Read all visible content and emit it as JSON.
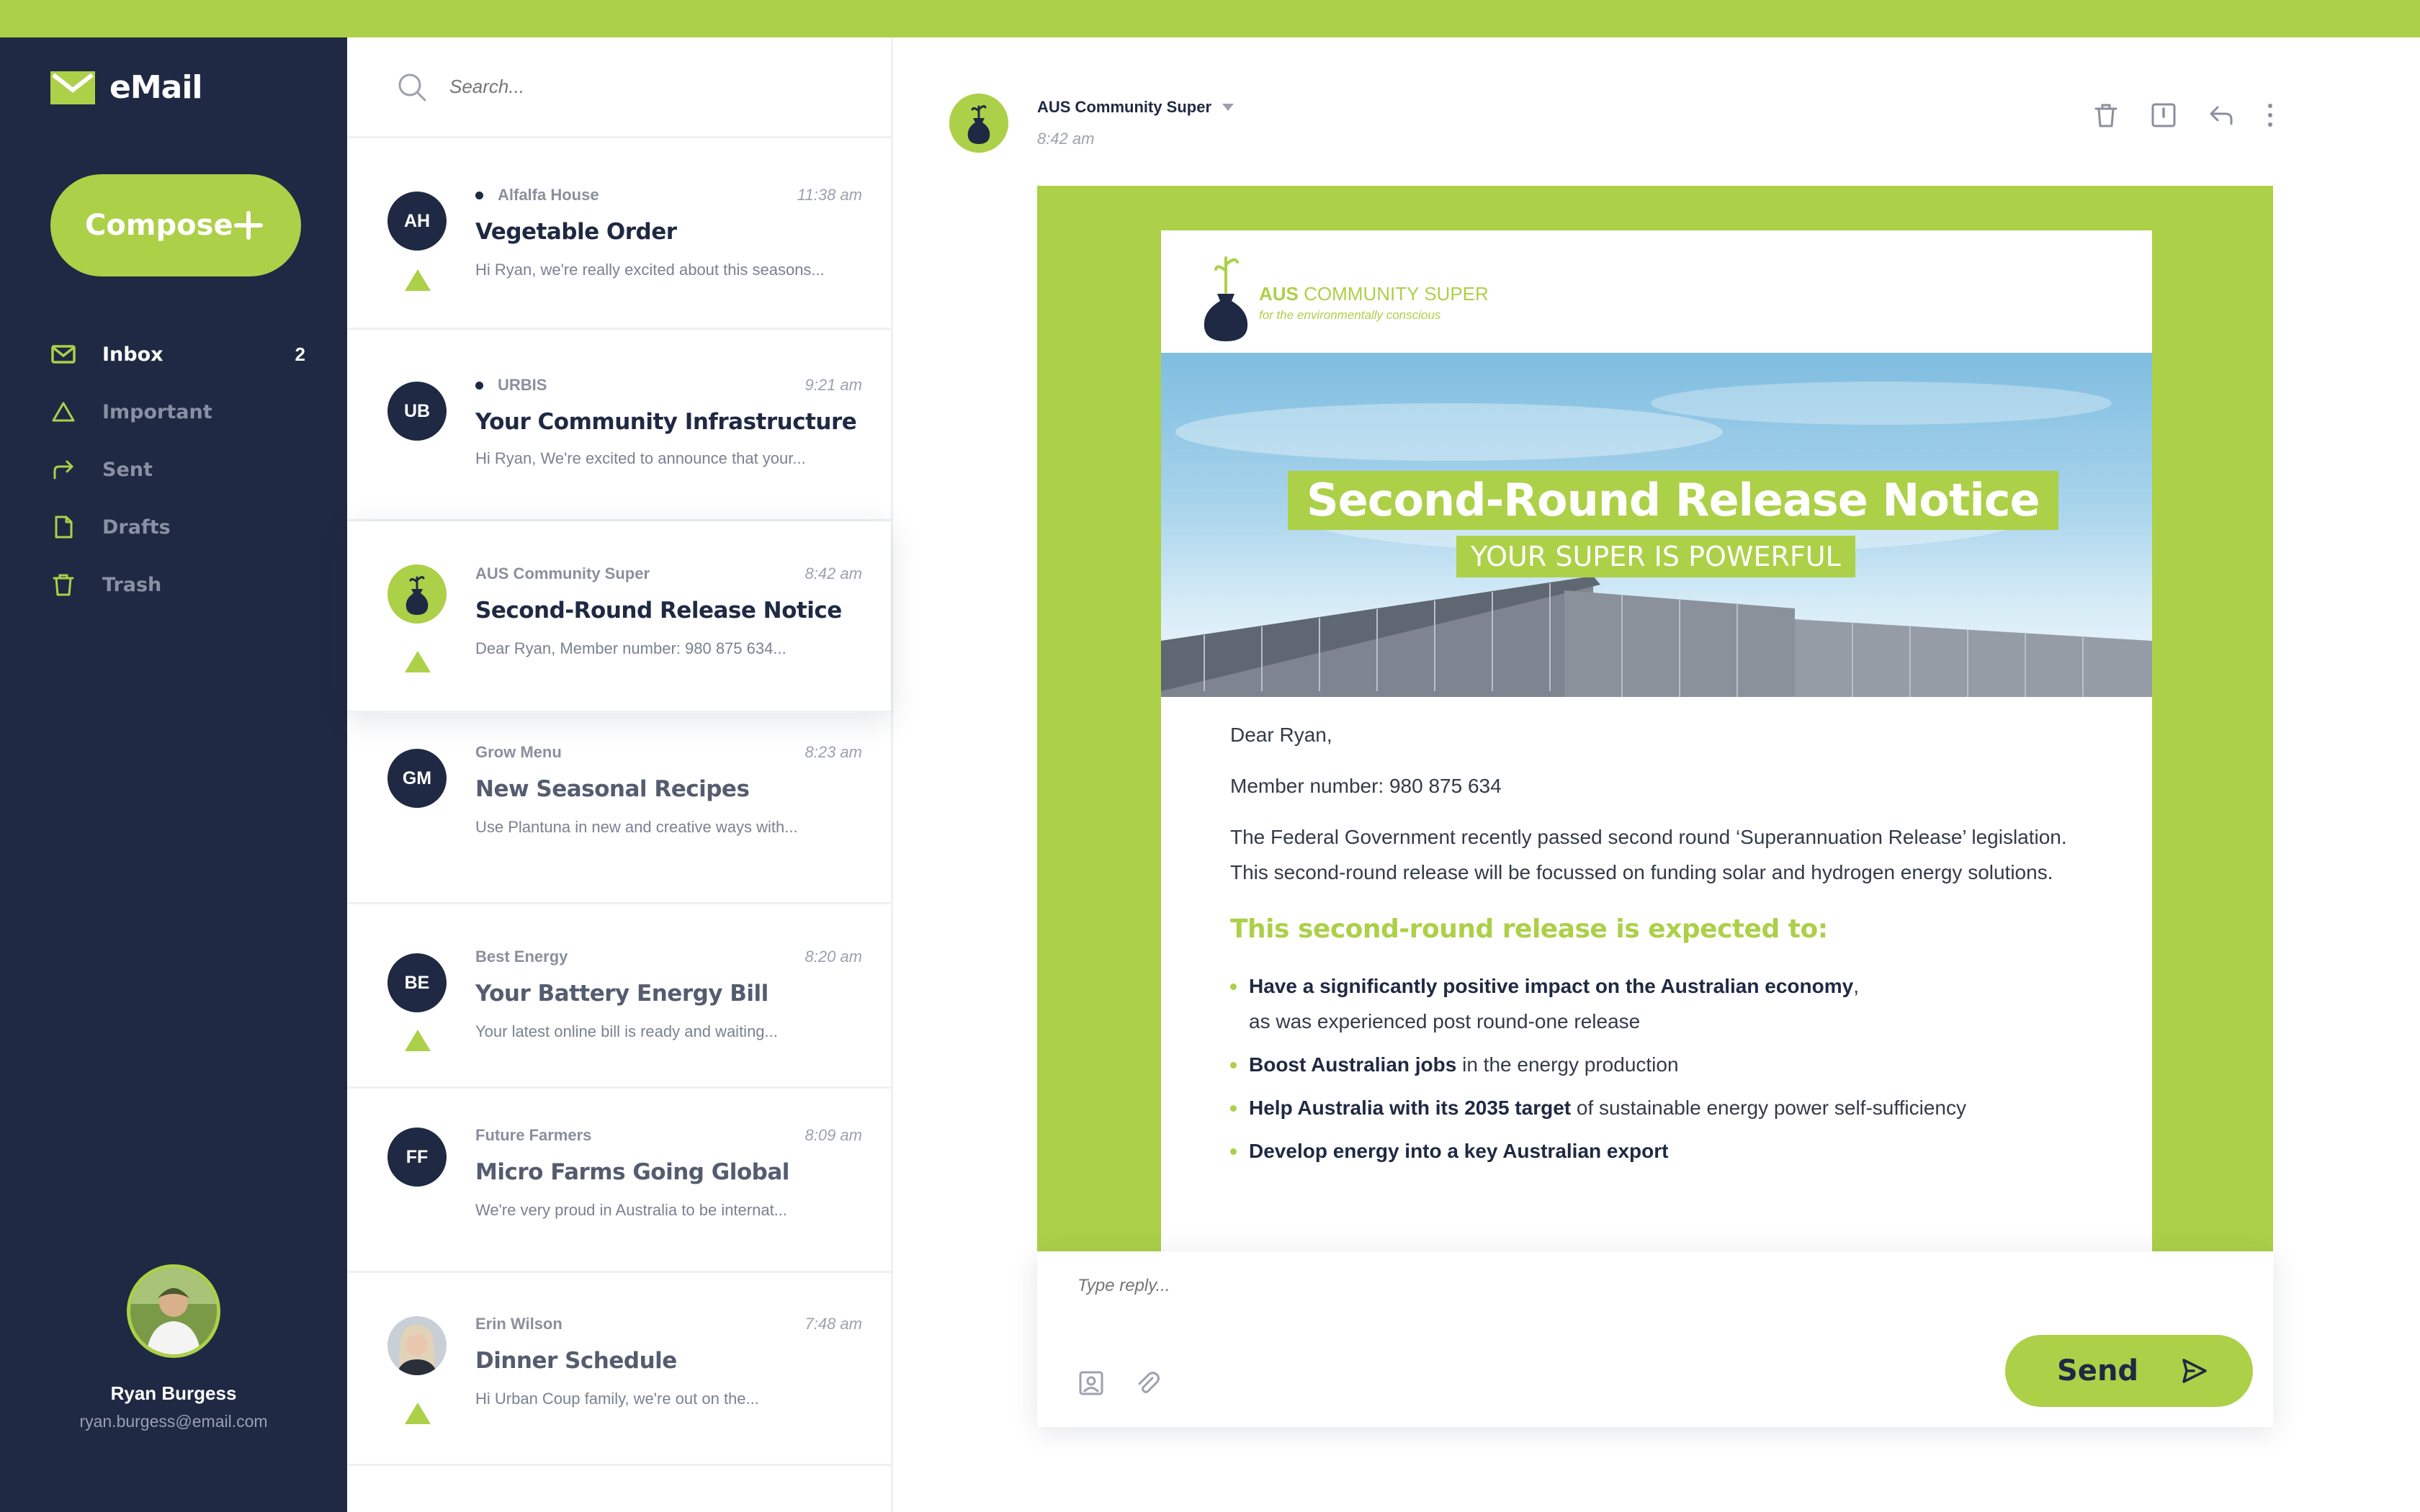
{
  "app": {
    "name": "eMail"
  },
  "sidebar": {
    "compose_label": "Compose",
    "nav": [
      {
        "label": "Inbox",
        "icon": "inbox-icon",
        "count": "2",
        "active": true
      },
      {
        "label": "Important",
        "icon": "important-icon"
      },
      {
        "label": "Sent",
        "icon": "sent-icon"
      },
      {
        "label": "Drafts",
        "icon": "drafts-icon"
      },
      {
        "label": "Trash",
        "icon": "trash-icon"
      }
    ],
    "user": {
      "name": "Ryan Burgess",
      "email": "ryan.burgess@email.com"
    }
  },
  "search": {
    "placeholder": "Search..."
  },
  "messages": [
    {
      "initials": "AH",
      "sender": "Alfalfa House",
      "unread": true,
      "time": "11:38 am",
      "subject": "Vegetable Order",
      "preview": "Hi Ryan, we're really excited about this seasons...",
      "important": true
    },
    {
      "initials": "UB",
      "sender": "URBIS",
      "unread": true,
      "time": "9:21 am",
      "subject": "Your Community Infrastructure",
      "preview": "Hi Ryan, We're excited to announce that your...",
      "important": false
    },
    {
      "initials": "",
      "sender": "AUS Community Super",
      "unread": false,
      "time": "8:42 am",
      "subject": "Second-Round Release Notice",
      "preview": "Dear Ryan, Member number: 980 875 634...",
      "important": true,
      "selected": true
    },
    {
      "initials": "GM",
      "sender": "Grow Menu",
      "unread": false,
      "time": "8:23 am",
      "subject": "New Seasonal Recipes",
      "preview": "Use Plantuna in new and creative ways with...",
      "important": false
    },
    {
      "initials": "BE",
      "sender": "Best Energy",
      "unread": false,
      "time": "8:20 am",
      "subject": "Your Battery Energy Bill",
      "preview": "Your latest online bill is ready and waiting...",
      "important": true
    },
    {
      "initials": "FF",
      "sender": "Future Farmers",
      "unread": false,
      "time": "8:09 am",
      "subject": "Micro Farms Going Global",
      "preview": "We're very proud in Australia to be internat...",
      "important": false
    },
    {
      "initials": "",
      "sender": "Erin Wilson",
      "unread": false,
      "time": "7:48 am",
      "subject": "Dinner Schedule",
      "preview": "Hi Urban Coup family, we're out on the...",
      "important": true
    }
  ],
  "reading": {
    "from": "AUS Community Super",
    "time": "8:42 am",
    "brand": {
      "name_bold": "AUS",
      "name_rest": " COMMUNITY SUPER",
      "tagline": "for the environmentally conscious"
    },
    "hero_title": "Second-Round Release Notice",
    "hero_subtitle": "YOUR SUPER IS POWERFUL",
    "greeting": "Dear Ryan,",
    "member": "Member number: 980 875 634",
    "paragraph": "The Federal Government recently passed second round ‘Superannuation Release’ legislation. This second-round release will be focussed on funding solar and hydrogen energy solutions.",
    "heading": "This second-round release is expected to:",
    "bullets": [
      {
        "bold": "Have a significantly positive impact on the Australian economy",
        "rest": ",",
        "line2": "as was experienced post round-one release"
      },
      {
        "bold": "Boost Australian jobs",
        "rest": " in the energy production"
      },
      {
        "bold": "Help Australia with its 2035 target",
        "rest": " of sustainable energy power self-sufficiency"
      },
      {
        "bold": "Develop energy into a key Australian export",
        "rest": ""
      }
    ]
  },
  "reply": {
    "placeholder": "Type reply...",
    "send_label": "Send"
  },
  "colors": {
    "accent": "#acd048",
    "navy": "#1f2943"
  }
}
